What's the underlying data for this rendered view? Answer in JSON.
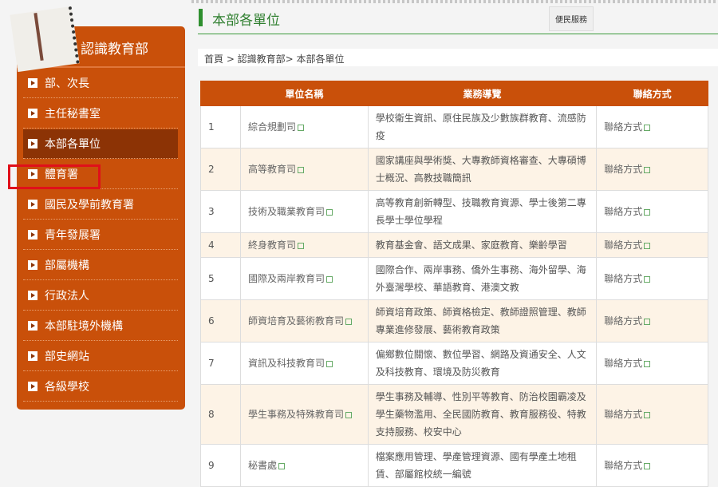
{
  "sidebar": {
    "title": "認識教育部",
    "items": [
      {
        "label": "部、次長"
      },
      {
        "label": "主任秘書室"
      },
      {
        "label": "本部各單位"
      },
      {
        "label": "體育署"
      },
      {
        "label": "國民及學前教育署"
      },
      {
        "label": "青年發展署"
      },
      {
        "label": "部屬機構"
      },
      {
        "label": "行政法人"
      },
      {
        "label": "本部駐境外機構"
      },
      {
        "label": "部史網站"
      },
      {
        "label": "各級學校"
      }
    ]
  },
  "header": {
    "title": "本部各單位",
    "service_button": "便民服務"
  },
  "breadcrumb": "首頁 > 認識教育部> 本部各單位",
  "table": {
    "headers": [
      "",
      "單位名稱",
      "業務導覽",
      "聯絡方式"
    ],
    "rows": [
      {
        "no": "1",
        "name": "綜合規劃司",
        "desc": "學校衛生資訊、原住民族及少數族群教育、流感防疫",
        "contact": "聯絡方式"
      },
      {
        "no": "2",
        "name": "高等教育司",
        "desc": "國家講座與學術獎、大專教師資格審查、大專碩博士概況、高教技職簡訊",
        "contact": "聯絡方式"
      },
      {
        "no": "3",
        "name": "技術及職業教育司",
        "desc": "高等教育創新轉型、技職教育資源、學士後第二專長學士學位學程",
        "contact": "聯絡方式"
      },
      {
        "no": "4",
        "name": "終身教育司",
        "desc": "教育基金會、語文成果、家庭教育、樂齡學習",
        "contact": "聯絡方式"
      },
      {
        "no": "5",
        "name": "國際及兩岸教育司",
        "desc": "國際合作、兩岸事務、僑外生事務、海外留學、海外臺灣學校、華語教育、港澳文教",
        "contact": "聯絡方式"
      },
      {
        "no": "6",
        "name": "師資培育及藝術教育司",
        "desc": "師資培育政策、師資格檢定、教師證照管理、教師專業進修發展、藝術教育政策",
        "contact": "聯絡方式"
      },
      {
        "no": "7",
        "name": "資訊及科技教育司",
        "desc": "偏鄉數位關懷、數位學習、網路及資通安全、人文及科技教育、環境及防災教育",
        "contact": "聯絡方式"
      },
      {
        "no": "8",
        "name": "學生事務及特殊教育司",
        "desc": "學生事務及輔導、性別平等教育、防治校園霸凌及學生藥物濫用、全民國防教育、教育服務役、特教支持服務、校安中心",
        "contact": "聯絡方式"
      },
      {
        "no": "9",
        "name": "秘書處",
        "desc": "檔案應用管理、學產管理資源、國有學產土地租賃、部屬館校統一編號",
        "contact": "聯絡方式"
      }
    ]
  }
}
